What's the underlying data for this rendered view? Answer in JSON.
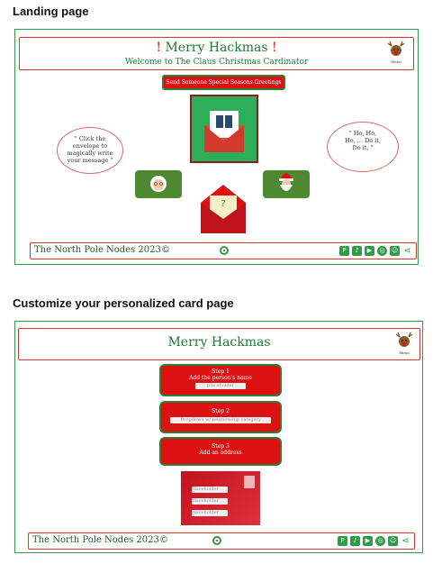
{
  "headings": {
    "landing": "Landing page",
    "customize": "Customize your personalized card page"
  },
  "landing": {
    "banner_bang_left": "!",
    "banner_title": "Merry Hackmas",
    "banner_bang_right": "!",
    "banner_subtitle": "Welcome to The Claus Christmas Cardinator",
    "menu_label": "Menu",
    "send_button": "Send Someone Special Seasons Greetings",
    "bubble_left": "\" Click the envelope to magically write your message \"",
    "bubble_right": "\" Ho, Ho, Ho, ... Do it, Do it. \"",
    "envelope_mark": "?"
  },
  "customize": {
    "banner_title": "Merry Hackmas",
    "menu_label": "Menu",
    "step1_title": "Step 1",
    "step1_text": "Add the person's name",
    "step1_placeholder": "placeholder",
    "step2_title": "Step 2",
    "step2_placeholder": "Dropdown w/ relationship category",
    "step3_title": "Step 3",
    "step3_text": "Add an address",
    "env_placeholder_1": "placeholder",
    "env_placeholder_2": "placeholder",
    "env_placeholder_3": "placeholder"
  },
  "footer": {
    "text": "The North Pole Nodes 2023©",
    "icons": [
      "pinterest-icon",
      "tiktok-icon",
      "youtube-icon",
      "instagram-icon",
      "snapchat-icon",
      "share-icon"
    ]
  },
  "colors": {
    "brand_green": "#2e9d4a",
    "brand_red": "#d11111"
  }
}
